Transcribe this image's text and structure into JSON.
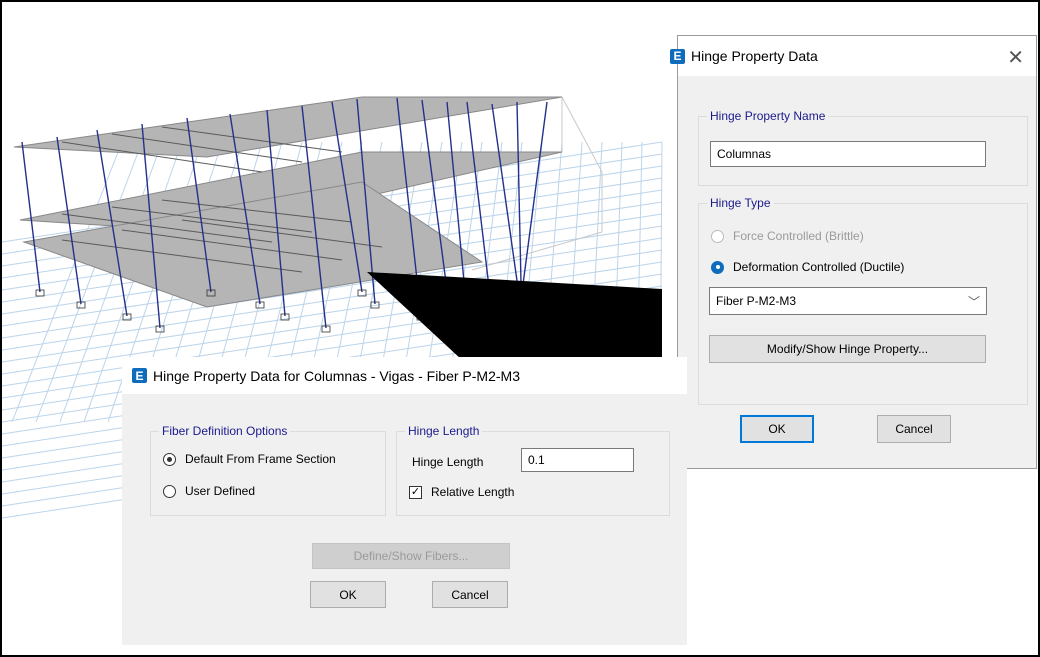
{
  "hinge_dialog": {
    "title": "Hinge Property Data",
    "name_group_label": "Hinge Property Name",
    "name_value": "Columnas",
    "type_group_label": "Hinge Type",
    "option_force": "Force Controlled  (Brittle)",
    "option_deformation": "Deformation Controlled  (Ductile)",
    "selected_option": "Deformation Controlled  (Ductile)",
    "hinge_kind_selected": "Fiber P-M2-M3",
    "modify_button": "Modify/Show Hinge Property...",
    "ok_button": "OK",
    "cancel_button": "Cancel"
  },
  "fiber_dialog": {
    "title": "Hinge Property Data for Columnas - Vigas - Fiber P-M2-M3",
    "fiber_group_label": "Fiber Definition Options",
    "option_default": "Default From Frame Section",
    "option_user": "User Defined",
    "selected_option": "Default From Frame Section",
    "length_group_label": "Hinge Length",
    "hinge_length_label": "Hinge Length",
    "hinge_length_value": "0.1",
    "relative_length_label": "Relative Length",
    "relative_length_checked": true,
    "define_fibers_button": "Define/Show Fibers...",
    "ok_button": "OK",
    "cancel_button": "Cancel"
  },
  "colors": {
    "accent": "#0f6cbd",
    "group_label": "#1a1a8c",
    "dialog_bg": "#f0f0f0"
  }
}
